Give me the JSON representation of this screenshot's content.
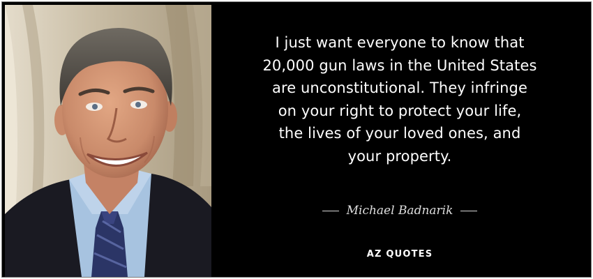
{
  "quote": {
    "lines": [
      "I just want everyone to know that",
      "20,000 gun laws in the United States",
      "are unconstitutional. They infringe",
      "on your right to protect your life,",
      "the lives of your loved ones, and",
      "your property."
    ]
  },
  "author": {
    "name": "Michael Badnarik"
  },
  "brand": {
    "logo_text": "AZ QUOTES"
  },
  "colors": {
    "background": "#000000",
    "text": "#ffffff",
    "frame": "#7a7a7a"
  }
}
